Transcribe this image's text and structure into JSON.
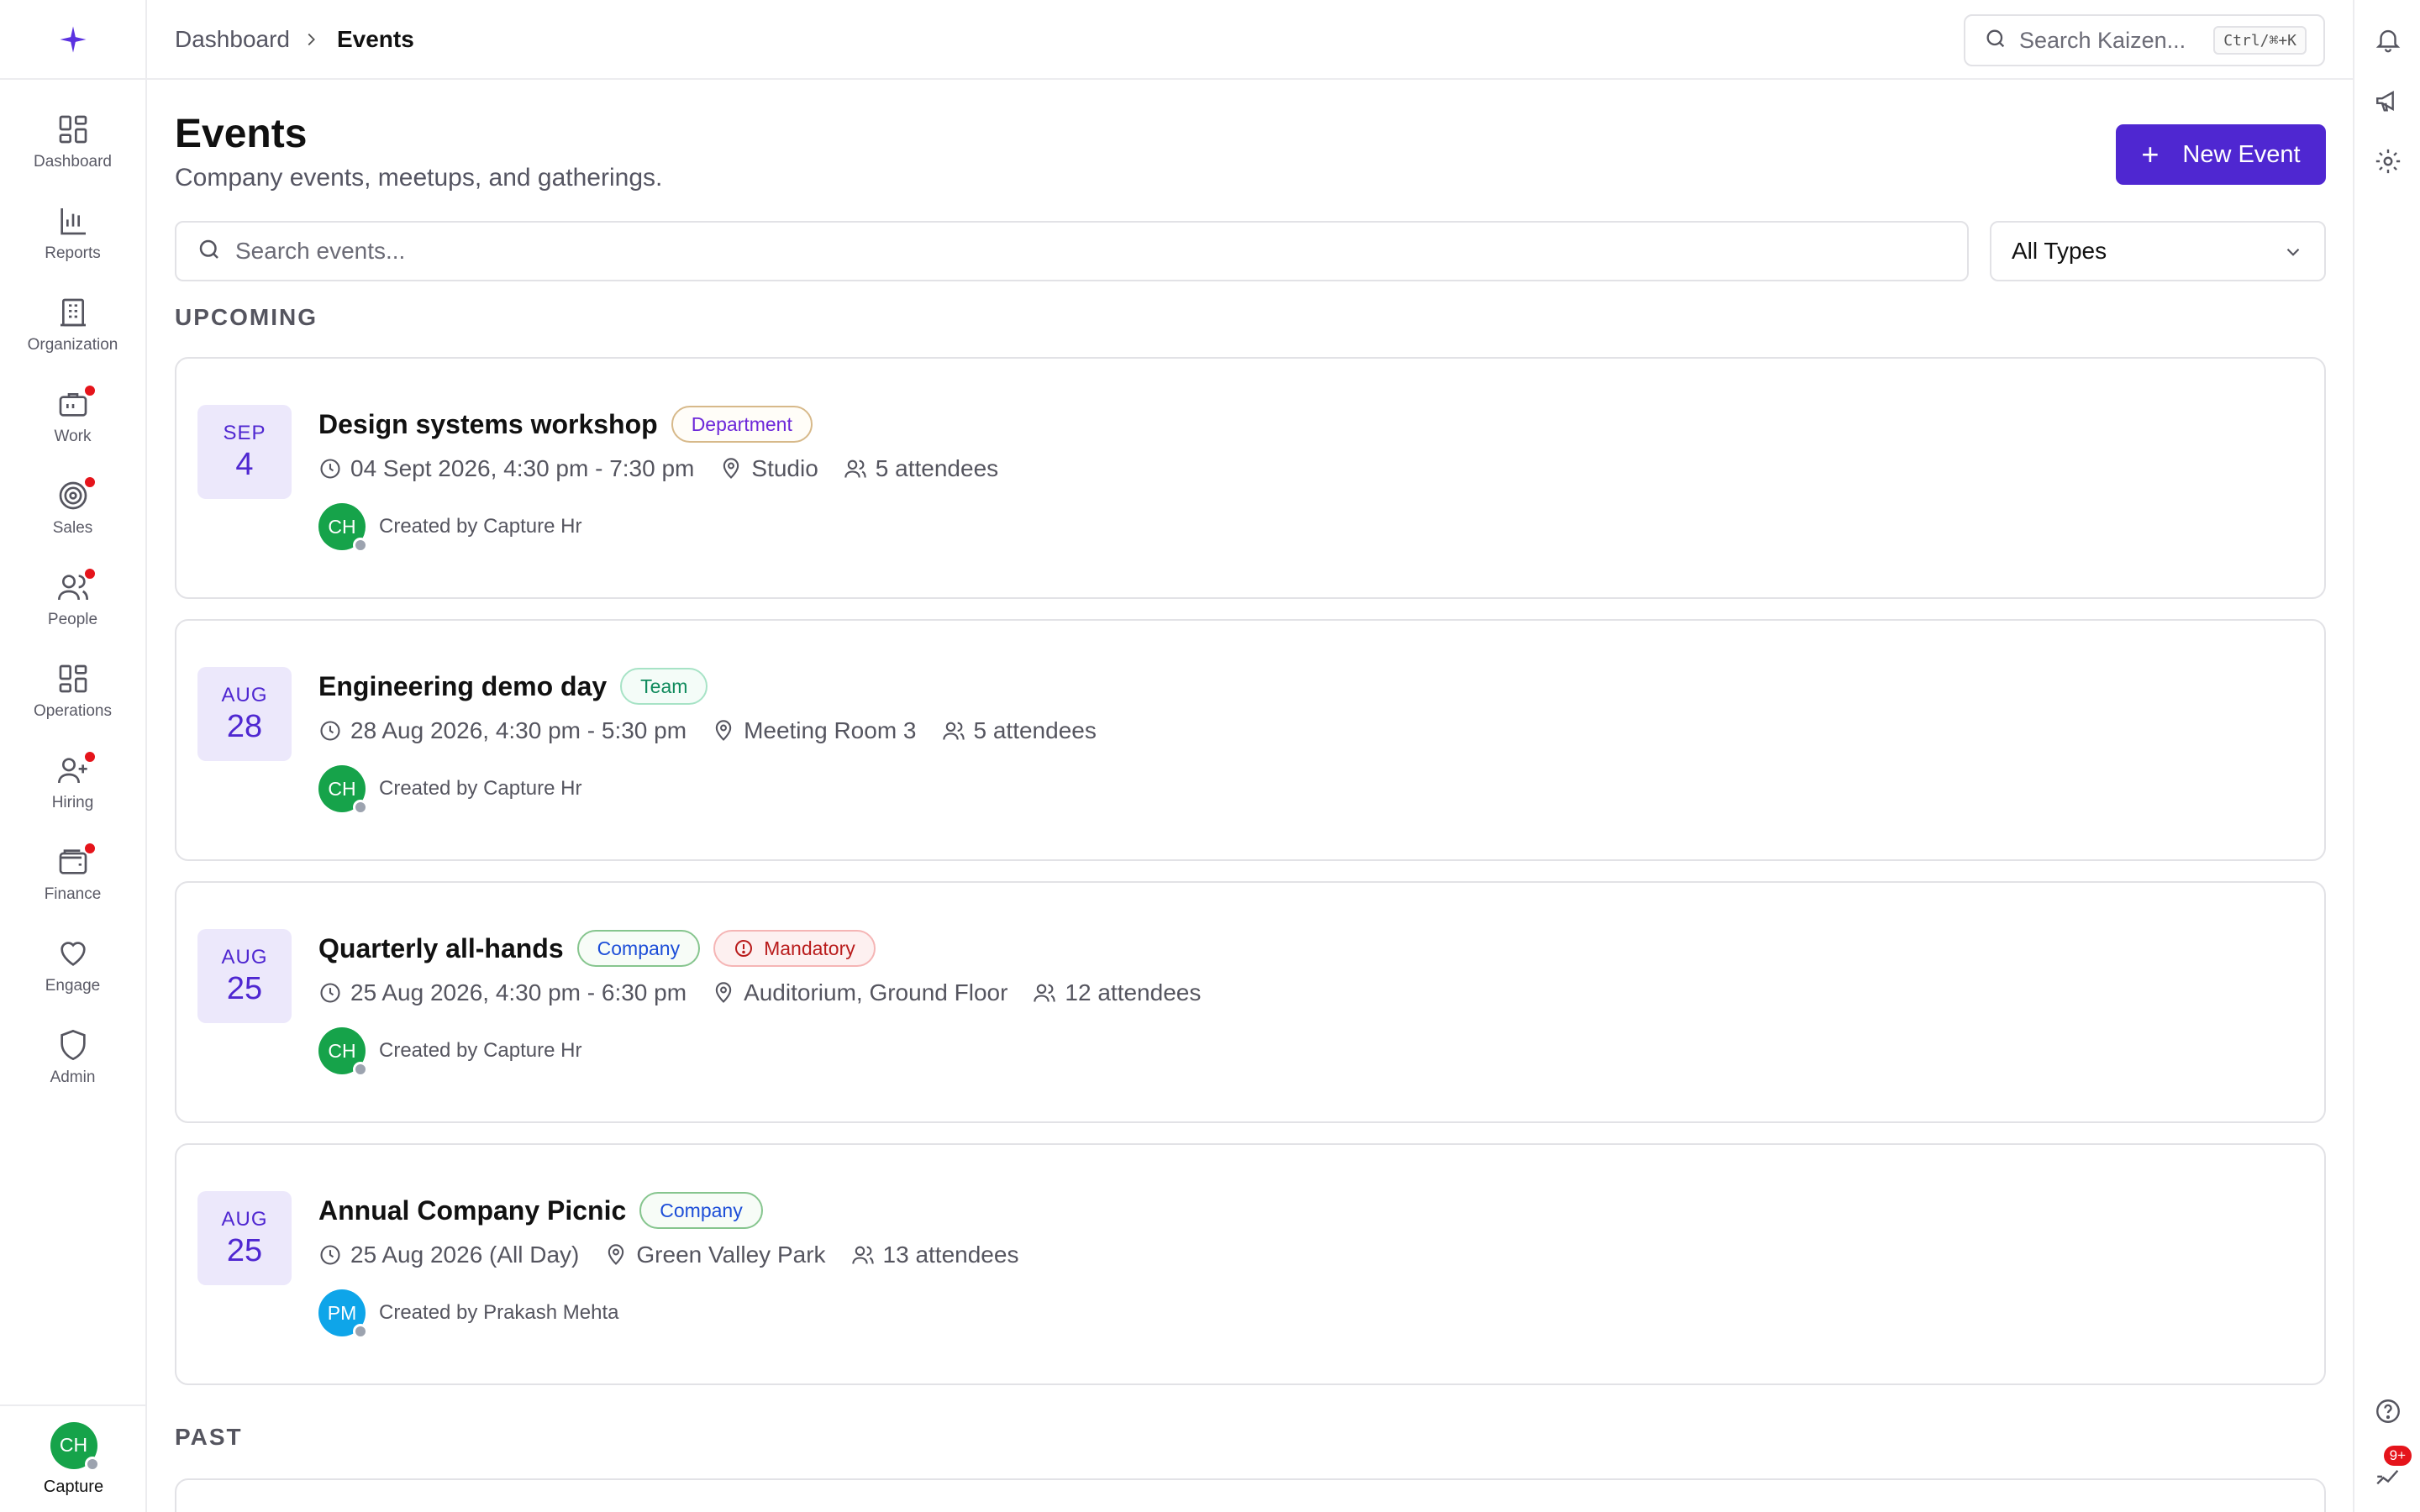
{
  "app": {
    "logo_icon": "sparkle-logo-icon",
    "accent": "#4f27d1"
  },
  "sidebar": {
    "items": [
      {
        "label": "Dashboard",
        "icon": "grid-icon",
        "has_dot": false
      },
      {
        "label": "Reports",
        "icon": "bar-chart-icon",
        "has_dot": false
      },
      {
        "label": "Organization",
        "icon": "building-icon",
        "has_dot": false
      },
      {
        "label": "Work",
        "icon": "briefcase-icon",
        "has_dot": true
      },
      {
        "label": "Sales",
        "icon": "target-icon",
        "has_dot": true
      },
      {
        "label": "People",
        "icon": "users-icon",
        "has_dot": true
      },
      {
        "label": "Operations",
        "icon": "grid-icon",
        "has_dot": false
      },
      {
        "label": "Hiring",
        "icon": "user-plus-icon",
        "has_dot": true
      },
      {
        "label": "Finance",
        "icon": "wallet-icon",
        "has_dot": true
      },
      {
        "label": "Engage",
        "icon": "heart-icon",
        "has_dot": false
      },
      {
        "label": "Admin",
        "icon": "shield-icon",
        "has_dot": false
      }
    ],
    "profile": {
      "initials": "CH",
      "name": "Capture"
    }
  },
  "topbar": {
    "breadcrumb": [
      "Dashboard",
      "Events"
    ],
    "search_placeholder": "Search Kaizen...",
    "shortcut": "Ctrl/⌘+K"
  },
  "rail": {
    "notification_badge": "9+"
  },
  "page": {
    "title": "Events",
    "subtitle": "Company events, meetups, and gatherings.",
    "new_button": "New Event",
    "search_placeholder": "Search events...",
    "type_filter": "All Types",
    "upcoming_label": "UPCOMING",
    "past_label": "PAST"
  },
  "events": [
    {
      "month": "SEP",
      "day": "4",
      "title": "Design systems workshop",
      "tags": [
        {
          "label": "Department",
          "kind": "dept"
        }
      ],
      "datetime": "04 Sept 2026, 4:30 pm - 7:30 pm",
      "location": "Studio",
      "attendees": "5 attendees",
      "creator_initials": "CH",
      "creator": "Created by Capture Hr",
      "avatar_color": "#16a34a"
    },
    {
      "month": "AUG",
      "day": "28",
      "title": "Engineering demo day",
      "tags": [
        {
          "label": "Team",
          "kind": "team"
        }
      ],
      "datetime": "28 Aug 2026, 4:30 pm - 5:30 pm",
      "location": "Meeting Room 3",
      "attendees": "5 attendees",
      "creator_initials": "CH",
      "creator": "Created by Capture Hr",
      "avatar_color": "#16a34a"
    },
    {
      "month": "AUG",
      "day": "25",
      "title": "Quarterly all-hands",
      "tags": [
        {
          "label": "Company",
          "kind": "comp"
        },
        {
          "label": "Mandatory",
          "kind": "mand"
        }
      ],
      "datetime": "25 Aug 2026, 4:30 pm - 6:30 pm",
      "location": "Auditorium, Ground Floor",
      "attendees": "12 attendees",
      "creator_initials": "CH",
      "creator": "Created by Capture Hr",
      "avatar_color": "#16a34a"
    },
    {
      "month": "AUG",
      "day": "25",
      "title": "Annual Company Picnic",
      "tags": [
        {
          "label": "Company",
          "kind": "comp"
        }
      ],
      "datetime": "25 Aug 2026 (All Day)",
      "location": "Green Valley Park",
      "attendees": "13 attendees",
      "creator_initials": "PM",
      "creator": "Created by Prakash Mehta",
      "avatar_color": "#0ea5e9"
    }
  ]
}
